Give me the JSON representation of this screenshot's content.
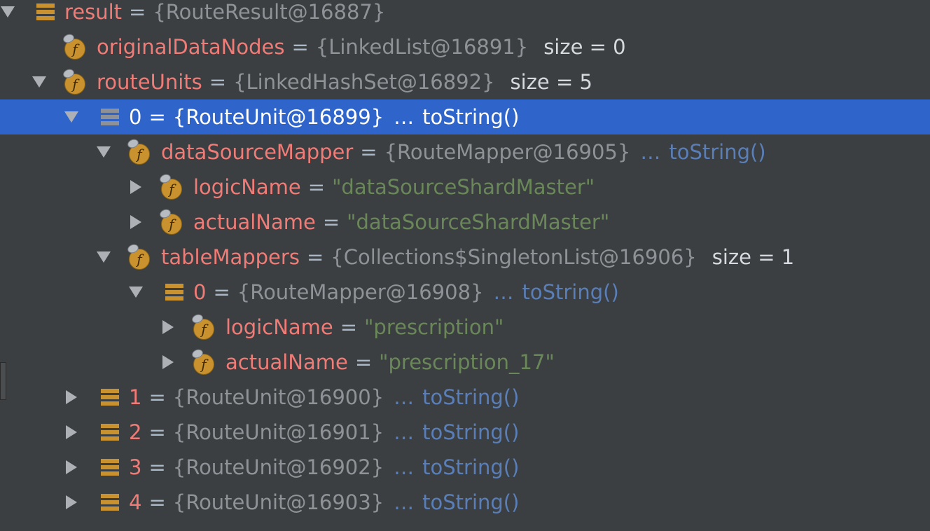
{
  "tree": {
    "rows": [
      {
        "name": "result",
        "value": "{RouteResult@16887}"
      },
      {
        "name": "originalDataNodes",
        "value": "{LinkedList@16891}",
        "size": "size = 0"
      },
      {
        "name": "routeUnits",
        "value": "{LinkedHashSet@16892}",
        "size": "size = 5"
      },
      {
        "name": "0",
        "value": "{RouteUnit@16899}",
        "more": "…",
        "tostring": "toString()"
      },
      {
        "name": "dataSourceMapper",
        "value": "{RouteMapper@16905}",
        "more": "…",
        "tostring": "toString()"
      },
      {
        "name": "logicName",
        "value": "\"dataSourceShardMaster\""
      },
      {
        "name": "actualName",
        "value": "\"dataSourceShardMaster\""
      },
      {
        "name": "tableMappers",
        "value": "{Collections$SingletonList@16906}",
        "size": "size = 1"
      },
      {
        "name": "0",
        "value": "{RouteMapper@16908}",
        "more": "…",
        "tostring": "toString()"
      },
      {
        "name": "logicName",
        "value": "\"prescription\""
      },
      {
        "name": "actualName",
        "value": "\"prescription_17\""
      },
      {
        "name": "1",
        "value": "{RouteUnit@16900}",
        "more": "…",
        "tostring": "toString()"
      },
      {
        "name": "2",
        "value": "{RouteUnit@16901}",
        "more": "…",
        "tostring": "toString()"
      },
      {
        "name": "3",
        "value": "{RouteUnit@16902}",
        "more": "…",
        "tostring": "toString()"
      },
      {
        "name": "4",
        "value": "{RouteUnit@16903}",
        "more": "…",
        "tostring": "toString()"
      }
    ],
    "eq": "="
  },
  "colors": {
    "background": "#3c3f41",
    "selection": "#2f65ca",
    "field_name": "#f07c78",
    "string_value": "#6a8759",
    "link": "#5a7fb8"
  },
  "icons": {
    "field": "field-icon",
    "array": "array-element-icon",
    "expand": "expand-arrow-icon",
    "collapse": "collapse-arrow-icon"
  }
}
